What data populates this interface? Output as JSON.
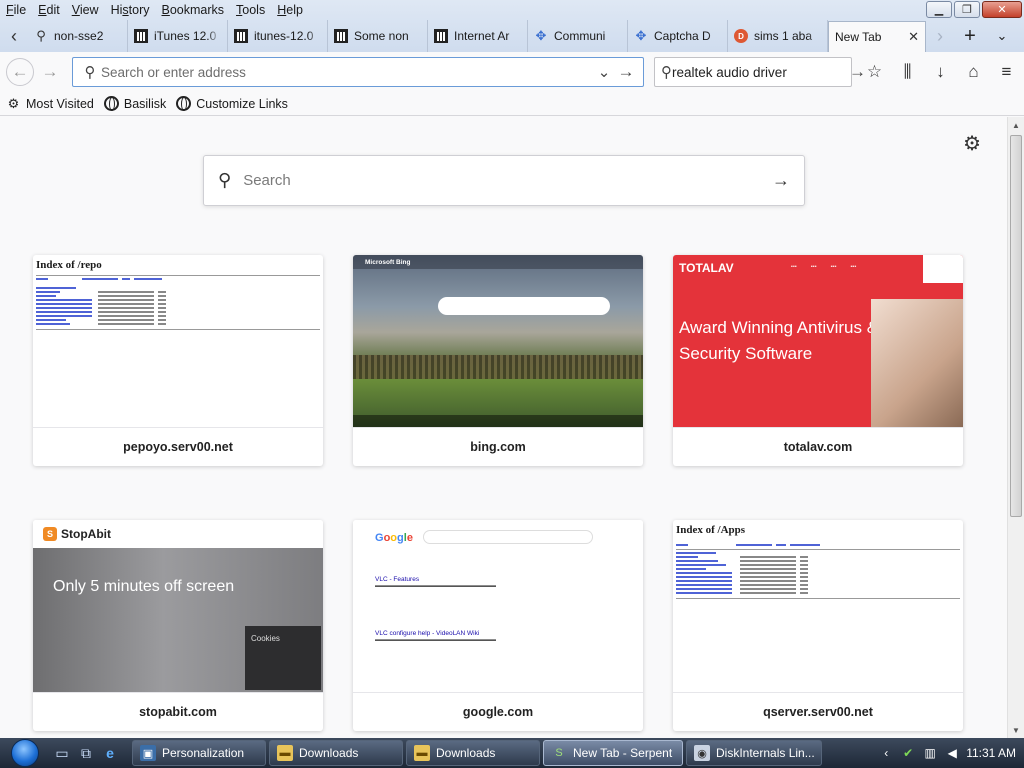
{
  "menubar": {
    "items": [
      {
        "label": "File",
        "accel": "F"
      },
      {
        "label": "Edit",
        "accel": "E"
      },
      {
        "label": "View",
        "accel": "V"
      },
      {
        "label": "History",
        "accel": "s"
      },
      {
        "label": "Bookmarks",
        "accel": "B"
      },
      {
        "label": "Tools",
        "accel": "T"
      },
      {
        "label": "Help",
        "accel": "H"
      }
    ]
  },
  "tabs": [
    {
      "label": "non-sse2",
      "favicon": "search-icon"
    },
    {
      "label": "iTunes 12.0",
      "favicon": "archive-icon"
    },
    {
      "label": "itunes-12.0",
      "favicon": "archive-icon"
    },
    {
      "label": "Some non",
      "favicon": "archive-icon"
    },
    {
      "label": "Internet Ar",
      "favicon": "archive-icon"
    },
    {
      "label": "Communi",
      "favicon": "puzzle-icon"
    },
    {
      "label": "Captcha D",
      "favicon": "puzzle-icon"
    },
    {
      "label": "sims 1 aba",
      "favicon": "duckduckgo-icon"
    },
    {
      "label": "New Tab",
      "favicon": "",
      "active": true
    }
  ],
  "navbar": {
    "url_placeholder": "Search or enter address",
    "search_value": "realtek audio driver"
  },
  "bookmarks": [
    {
      "label": "Most Visited",
      "icon": "gear-icon"
    },
    {
      "label": "Basilisk",
      "icon": "globe-icon"
    },
    {
      "label": "Customize Links",
      "icon": "globe-icon"
    }
  ],
  "newtab": {
    "search_placeholder": "Search",
    "tiles": [
      {
        "label": "pepoyo.serv00.net",
        "thumb_title": "Index of /repo"
      },
      {
        "label": "bing.com",
        "thumb_title": "Microsoft Bing"
      },
      {
        "label": "totalav.com",
        "thumb_brand": "TOTALAV",
        "thumb_title": "Award Winning Antivirus & Security Software"
      },
      {
        "label": "stopabit.com",
        "thumb_brand": "StopAbit",
        "thumb_title": "Only 5 minutes off screen",
        "thumb_note": "Cookies"
      },
      {
        "label": "google.com",
        "thumb_brand": "Google",
        "thumb_results": [
          "VLC - Features",
          "VLC configure help - VideoLAN Wiki"
        ]
      },
      {
        "label": "qserver.serv00.net",
        "thumb_title": "Index of /Apps"
      }
    ]
  },
  "taskbar": {
    "tasks": [
      {
        "label": "Personalization",
        "icon": "monitor-icon"
      },
      {
        "label": "Downloads",
        "icon": "folder-icon"
      },
      {
        "label": "Downloads",
        "icon": "folder-icon"
      },
      {
        "label": "New Tab - Serpent",
        "icon": "browser-icon",
        "active": true
      },
      {
        "label": "DiskInternals Lin...",
        "icon": "disk-icon"
      }
    ],
    "clock": "11:31 AM"
  },
  "colors": {
    "tab_strip": "#cfdcee",
    "url_focus": "#6a9bd8",
    "taskbar": "#1d2736",
    "totalav_red": "#e4333a",
    "link_blue": "#4f63d6"
  }
}
